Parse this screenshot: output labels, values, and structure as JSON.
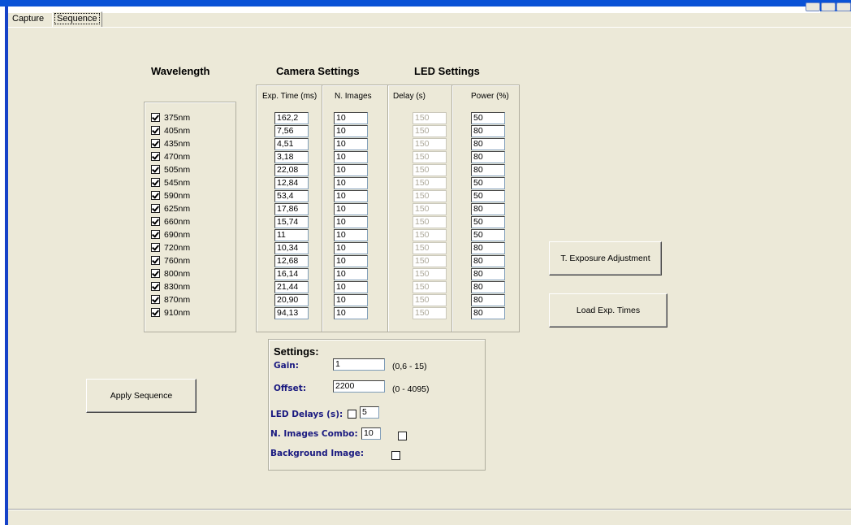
{
  "tabs": [
    {
      "label": "Capture"
    },
    {
      "label": "Sequence"
    }
  ],
  "headers": {
    "wavelength": "Wavelength",
    "camera": "Camera Settings",
    "led": "LED Settings"
  },
  "columns": {
    "exp_time": "Exp. Time (ms)",
    "n_images": "N. Images",
    "delay": "Delay (s)",
    "power": "Power (%)"
  },
  "wavelengths": [
    {
      "label": "375nm",
      "checked": true,
      "exp": "162,2",
      "n": "10",
      "delay": "150",
      "power": "50"
    },
    {
      "label": "405nm",
      "checked": true,
      "exp": "7,56",
      "n": "10",
      "delay": "150",
      "power": "80"
    },
    {
      "label": "435nm",
      "checked": true,
      "exp": "4,51",
      "n": "10",
      "delay": "150",
      "power": "80"
    },
    {
      "label": "470nm",
      "checked": true,
      "exp": "3,18",
      "n": "10",
      "delay": "150",
      "power": "80"
    },
    {
      "label": "505nm",
      "checked": true,
      "exp": "22,08",
      "n": "10",
      "delay": "150",
      "power": "80"
    },
    {
      "label": "545nm",
      "checked": true,
      "exp": "12,84",
      "n": "10",
      "delay": "150",
      "power": "50"
    },
    {
      "label": "590nm",
      "checked": true,
      "exp": "53,4",
      "n": "10",
      "delay": "150",
      "power": "50"
    },
    {
      "label": "625nm",
      "checked": true,
      "exp": "17,86",
      "n": "10",
      "delay": "150",
      "power": "80"
    },
    {
      "label": "660nm",
      "checked": true,
      "exp": "15,74",
      "n": "10",
      "delay": "150",
      "power": "50"
    },
    {
      "label": "690nm",
      "checked": true,
      "exp": "11",
      "n": "10",
      "delay": "150",
      "power": "50"
    },
    {
      "label": "720nm",
      "checked": true,
      "exp": "10,34",
      "n": "10",
      "delay": "150",
      "power": "80"
    },
    {
      "label": "760nm",
      "checked": true,
      "exp": "12,68",
      "n": "10",
      "delay": "150",
      "power": "80"
    },
    {
      "label": "800nm",
      "checked": true,
      "exp": "16,14",
      "n": "10",
      "delay": "150",
      "power": "80"
    },
    {
      "label": "830nm",
      "checked": true,
      "exp": "21,44",
      "n": "10",
      "delay": "150",
      "power": "80"
    },
    {
      "label": "870nm",
      "checked": true,
      "exp": "20,90",
      "n": "10",
      "delay": "150",
      "power": "80"
    },
    {
      "label": "910nm",
      "checked": true,
      "exp": "94,13",
      "n": "10",
      "delay": "150",
      "power": "80"
    }
  ],
  "buttons": {
    "exposure_adjust": "T. Exposure Adjustment",
    "load_exp": "Load Exp. Times",
    "apply_sequence": "Apply Sequence"
  },
  "settings": {
    "title": "Settings:",
    "gain_label": "Gain:",
    "gain_value": "1",
    "gain_range": "(0,6 - 15)",
    "offset_label": "Offset:",
    "offset_value": "2200",
    "offset_range": "(0 - 4095)",
    "led_delays_label": "LED Delays (s):",
    "led_delays_checked": false,
    "led_delays_value": "5",
    "n_images_combo_label": "N. Images Combo:",
    "n_images_combo_value": "10",
    "n_images_combo_checked": false,
    "background_label": "Background Image:",
    "background_checked": false
  }
}
